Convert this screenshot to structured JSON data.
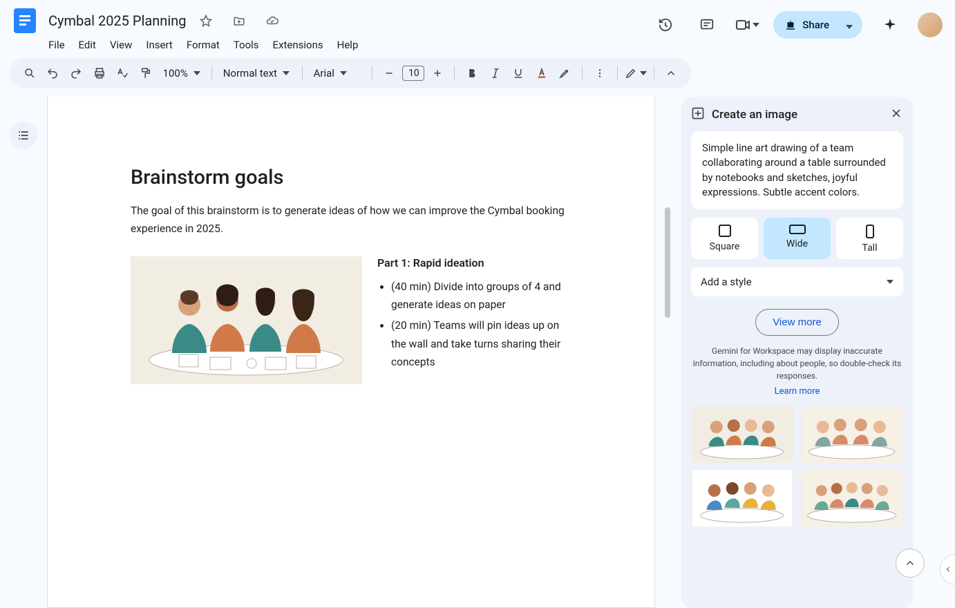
{
  "doc": {
    "title": "Cymbal 2025 Planning"
  },
  "menus": {
    "file": "File",
    "edit": "Edit",
    "view": "View",
    "insert": "Insert",
    "format": "Format",
    "tools": "Tools",
    "extensions": "Extensions",
    "help": "Help"
  },
  "header": {
    "share": "Share"
  },
  "toolbar": {
    "zoom": "100%",
    "style": "Normal text",
    "font": "Arial",
    "fontSize": "10"
  },
  "content": {
    "heading": "Brainstorm goals",
    "intro": "The goal of this brainstorm is to generate ideas of how we can improve the Cymbal booking experience in 2025.",
    "partTitle": "Part 1: Rapid ideation",
    "bullets": [
      "(40 min) Divide into groups of 4 and generate ideas on paper",
      "(20 min) Teams will pin ideas up on the wall and take turns sharing their concepts"
    ]
  },
  "sidebar": {
    "title": "Create an image",
    "prompt": "Simple line art drawing of a team collaborating around a table surrounded by notebooks and sketches, joyful expressions. Subtle accent colors.",
    "aspects": {
      "square": "Square",
      "wide": "Wide",
      "tall": "Tall"
    },
    "styleLabel": "Add a style",
    "viewMore": "View more",
    "disclaimer": "Gemini for Workspace may display inaccurate information, including about people, so double-check its responses.",
    "learnMore": "Learn more"
  }
}
